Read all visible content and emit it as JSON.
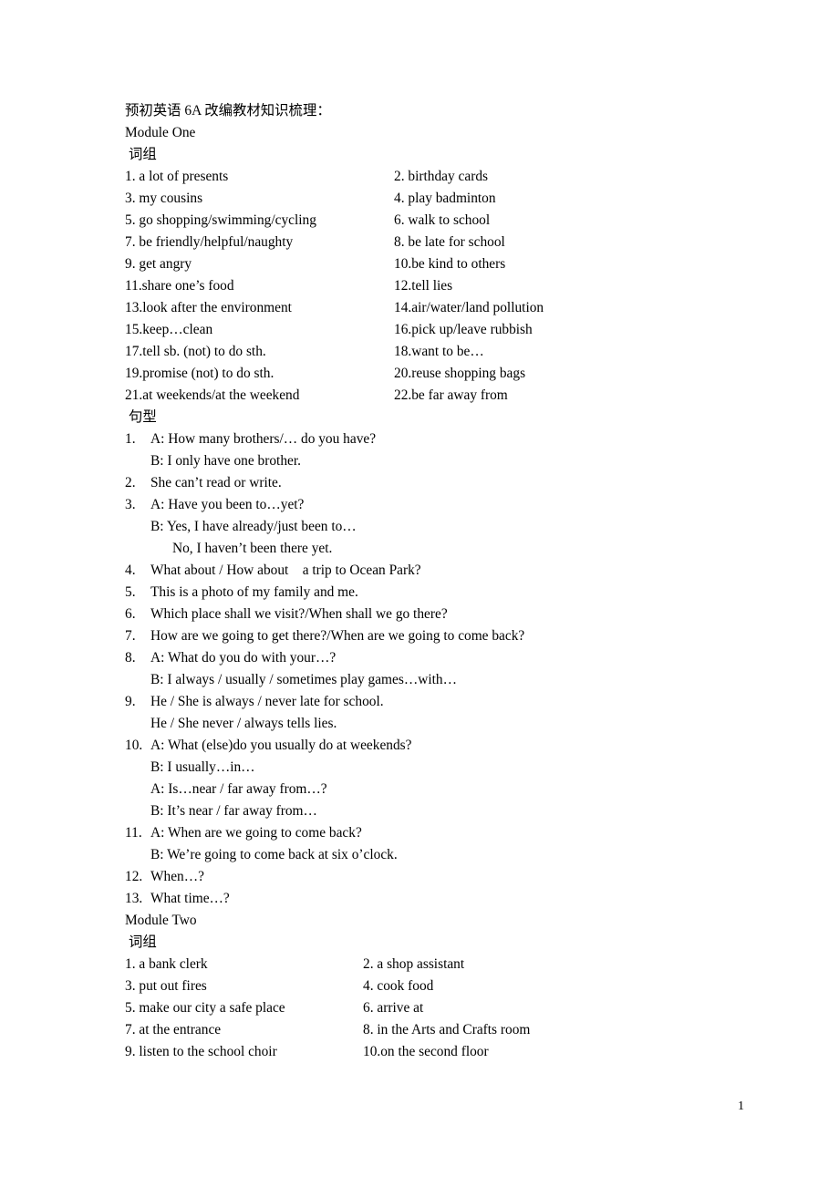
{
  "document": {
    "title": "预初英语 6A 改编教材知识梳理：",
    "page_number": "1"
  },
  "module_one": {
    "heading": "Module One",
    "phrases_heading": "词组",
    "patterns_heading": "句型",
    "phrases": [
      {
        "left": "1. a lot of presents",
        "right": "2. birthday cards"
      },
      {
        "left": "3. my cousins",
        "right": "4. play badminton"
      },
      {
        "left": "5. go shopping/swimming/cycling",
        "right": "6. walk to school"
      },
      {
        "left": "7. be friendly/helpful/naughty",
        "right": "8. be late for school"
      },
      {
        "left": "9. get angry",
        "right": "10.be kind to others"
      },
      {
        "left": "11.share one’s food",
        "right": "12.tell lies"
      },
      {
        "left": "13.look after the environment",
        "right": "14.air/water/land pollution"
      },
      {
        "left": "15.keep…clean",
        "right": "16.pick up/leave rubbish"
      },
      {
        "left": "17.tell sb. (not) to do sth.",
        "right": "18.want to be…"
      },
      {
        "left": "19.promise (not) to do sth.",
        "right": "20.reuse shopping bags"
      },
      {
        "left": "21.at weekends/at the weekend",
        "right": "22.be far away from"
      }
    ],
    "patterns": [
      {
        "number": "1.",
        "text": "A: How many brothers/… do you have?",
        "sub": [
          "B: I only have one brother."
        ]
      },
      {
        "number": "2.",
        "text": "She can’t read or write.",
        "sub": []
      },
      {
        "number": "3.",
        "text": "A: Have you been to…yet?",
        "sub": [
          "B: Yes, I have already/just been to…"
        ],
        "sub_deep": [
          "No, I haven’t been there yet."
        ]
      },
      {
        "number": "4.",
        "text": "What about / How about    a trip to Ocean Park?",
        "sub": []
      },
      {
        "number": "5.",
        "text": "This is a photo of my family and me.",
        "sub": []
      },
      {
        "number": "6.",
        "text": "Which place shall we visit?/When shall we go there?",
        "sub": []
      },
      {
        "number": "7.",
        "text": "How are we going to get there?/When are we going to come back?",
        "sub": []
      },
      {
        "number": "8.",
        "text": "A: What do you do with your…?",
        "sub": [
          "B: I always / usually / sometimes play games…with…"
        ]
      },
      {
        "number": "9.",
        "text": "He / She is always / never late for school.",
        "sub": [
          "He / She never / always tells lies."
        ]
      },
      {
        "number": "10.",
        "text": "A: What (else)do you usually do at weekends?",
        "sub": [
          "B: I usually…in…",
          "A: Is…near / far away from…?",
          "B: It’s near / far away from…"
        ]
      },
      {
        "number": "11.",
        "text": "A: When are we going to come back?",
        "sub": [
          "B: We’re going to come back at six o’clock."
        ]
      },
      {
        "number": "12.",
        "text": "When…?",
        "sub": []
      },
      {
        "number": "13.",
        "text": "What time…?",
        "sub": []
      }
    ]
  },
  "module_two": {
    "heading": "Module Two",
    "phrases_heading": "词组",
    "phrases": [
      {
        "left": "1. a bank clerk",
        "right": "2. a shop assistant"
      },
      {
        "left": "3. put out fires",
        "right": "4. cook food"
      },
      {
        "left": "5. make our city a safe place",
        "right": "6. arrive at"
      },
      {
        "left": "7. at the entrance",
        "right": "8. in the Arts and Crafts room"
      },
      {
        "left": "9. listen to the school choir",
        "right": "10.on the second floor"
      }
    ]
  }
}
